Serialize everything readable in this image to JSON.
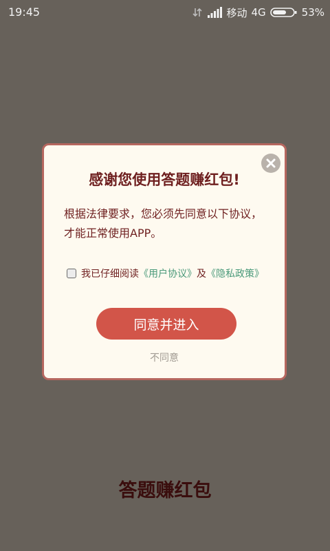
{
  "status_bar": {
    "time": "19:45",
    "carrier": "移动",
    "network": "4G",
    "battery": "53%"
  },
  "dialog": {
    "title": "感谢您使用答题赚红包!",
    "body": "根据法律要求，您必须先同意以下协议，才能正常使用APP。",
    "agree_prefix": "我已仔细阅读",
    "user_agreement_link": "《用户协议》",
    "agree_join": "及",
    "privacy_policy_link": "《隐私政策》",
    "enter_button": "同意并进入",
    "disagree_link": "不同意"
  },
  "footer": {
    "title": "答题赚红包"
  },
  "colors": {
    "background": "#67615a",
    "dialog_bg": "#fefaf0",
    "accent": "#d25549",
    "text": "#6e1f1f",
    "link": "#4a9a7a"
  }
}
